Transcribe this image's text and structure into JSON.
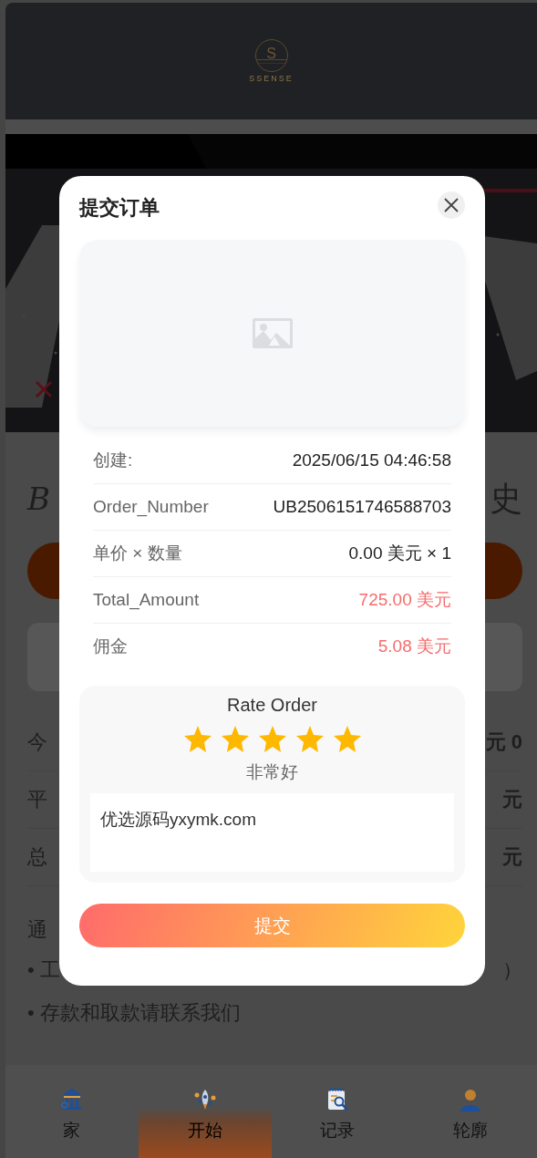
{
  "header": {
    "logo_letter": "S",
    "brand": "SSENSE"
  },
  "background": {
    "title_left": "B",
    "title_right": "史",
    "stats": [
      {
        "label": "今",
        "value": "元 0"
      },
      {
        "label": "平",
        "value": "元"
      },
      {
        "label": "总",
        "value": "元"
      }
    ],
    "notice_title": "通",
    "notices": [
      {
        "left": "• 工",
        "right": "）"
      },
      {
        "left": "• 存款和取款请联系我们"
      }
    ]
  },
  "tabs": [
    {
      "label": "家",
      "selected": false,
      "kind": "bank"
    },
    {
      "label": "开始",
      "selected": true,
      "kind": "rocket"
    },
    {
      "label": "记录",
      "selected": false,
      "kind": "notepad"
    },
    {
      "label": "轮廓",
      "selected": false,
      "kind": "person"
    }
  ],
  "modal": {
    "title": "提交订单",
    "details": [
      {
        "label": "创建:",
        "value": "2025/06/15 04:46:58",
        "highlight": false
      },
      {
        "label": "Order_Number",
        "value": "UB2506151746588703",
        "highlight": false
      },
      {
        "label": "单价 × 数量",
        "value": "0.00 美元 × 1",
        "highlight": false
      },
      {
        "label": "Total_Amount",
        "value": "725.00 美元",
        "highlight": true
      },
      {
        "label": "佣金",
        "value": "5.08 美元",
        "highlight": true
      }
    ],
    "rating": {
      "title": "Rate Order",
      "stars": 5,
      "verdict": "非常好",
      "comment": "优选源码yxymk.com"
    },
    "submit": "提交"
  }
}
